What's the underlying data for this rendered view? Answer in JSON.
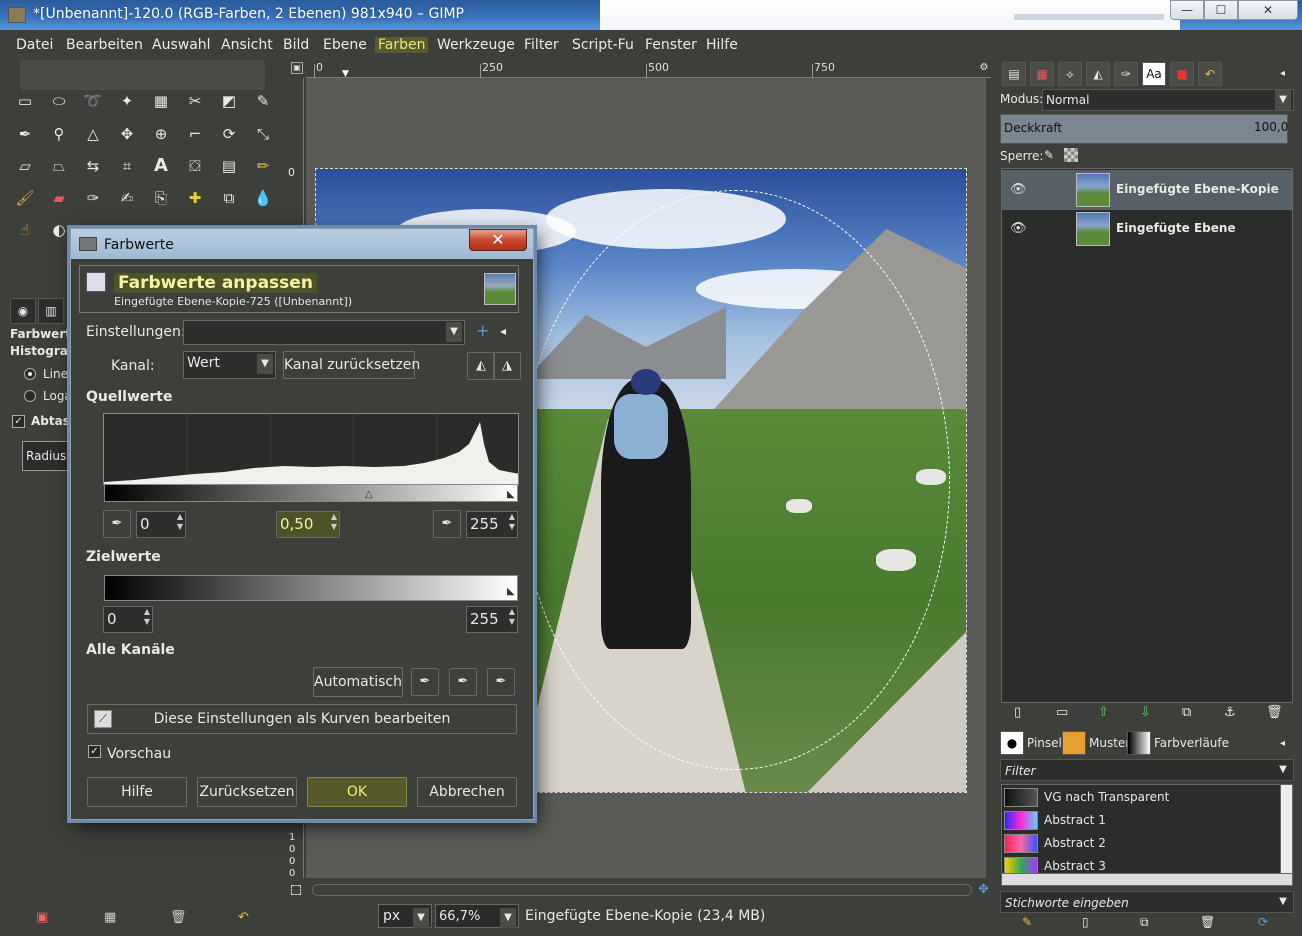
{
  "window": {
    "title": "*[Unbenannt]-120.0 (RGB-Farben, 2 Ebenen) 981x940 – GIMP",
    "minimize": "—",
    "maximize": "☐",
    "close": "✕"
  },
  "menu": {
    "items": [
      "Datei",
      "Bearbeiten",
      "Auswahl",
      "Ansicht",
      "Bild",
      "Ebene",
      "Farben",
      "Werkzeuge",
      "Filter",
      "Script-Fu",
      "Fenster",
      "Hilfe"
    ],
    "active": "Farben"
  },
  "toolbox": {
    "options_title_line1": "Farbwerte",
    "options_title_line2": "Histogram",
    "radio_linear": "Line",
    "radio_log": "Loga",
    "checkbox_label": "Abtast",
    "radius_label": "Radius",
    "tool_icons": [
      "rect-select-icon",
      "ellipse-select-icon",
      "lasso-icon",
      "fuzzy-select-icon",
      "color-select-icon",
      "scissors-icon",
      "foreground-select-icon",
      "paths-icon",
      "color-picker-icon",
      "zoom-icon",
      "measure-icon",
      "move-icon",
      "align-icon",
      "crop-icon",
      "rotate-icon",
      "scale-icon",
      "shear-icon",
      "perspective-icon",
      "flip-icon",
      "cage-icon",
      "text-icon",
      "bucket-fill-icon",
      "blend-icon",
      "pencil-icon",
      "paintbrush-icon",
      "eraser-icon",
      "airbrush-icon",
      "ink-icon",
      "clone-icon",
      "heal-icon",
      "perspective-clone-icon",
      "blur-icon",
      "smudge-icon",
      "dodge-icon"
    ]
  },
  "ruler": {
    "labels": [
      "0",
      "250",
      "500",
      "750"
    ],
    "vertical_labels": [
      "0"
    ],
    "vertical_bottom": [
      "1",
      "0",
      "0",
      "0"
    ]
  },
  "statusbar": {
    "unit": "px",
    "zoom": "66,7",
    "zoom_suffix": "%",
    "message": "Eingefügte Ebene-Kopie (23,4 MB)"
  },
  "layers_dock": {
    "mode_label": "Modus:",
    "mode_value": "Normal",
    "opacity_label": "Deckkraft",
    "opacity_value": "100,0",
    "lock_label": "Sperre:",
    "layers": [
      {
        "name": "Eingefügte Ebene-Kopie",
        "selected": true
      },
      {
        "name": "Eingefügte Ebene",
        "selected": false
      }
    ],
    "text_icon": "Aa"
  },
  "resources_dock": {
    "tabs": [
      "Pinsel",
      "Muster",
      "Farbverläufe"
    ],
    "filter_placeholder": "Filter",
    "gradients": [
      {
        "name": "VG nach Transparent",
        "colors": [
          "#111111",
          "#555555"
        ]
      },
      {
        "name": "Abstract 1",
        "colors": [
          "#2a2aff",
          "#ff2ad0",
          "#66ccff"
        ]
      },
      {
        "name": "Abstract 2",
        "colors": [
          "#ff2255",
          "#ff66aa",
          "#3355ff"
        ]
      },
      {
        "name": "Abstract 3",
        "colors": [
          "#ffcc00",
          "#33aa55",
          "#aa33ff"
        ]
      }
    ],
    "tags_placeholder": "Stichworte eingeben"
  },
  "dialog": {
    "title": "Farbwerte",
    "close": "✕",
    "header_title": "Farbwerte anpassen",
    "header_subtitle": "Eingefügte Ebene-Kopie-725 ([Unbenannt])",
    "settings_label": "Einstellungen:",
    "settings_value": "",
    "channel_label": "Kanal:",
    "channel_value": "Wert",
    "reset_channel": "Kanal zurücksetzen",
    "input_section": "Quellwerte",
    "input_low": "0",
    "input_gamma": "0,50",
    "input_high": "255",
    "output_section": "Zielwerte",
    "output_low": "0",
    "output_high": "255",
    "all_channels": "Alle Kanäle",
    "auto_button": "Automatisch",
    "curves_button": "Diese Einstellungen als Kurven bearbeiten",
    "preview_label": "Vorschau",
    "preview_checked": true,
    "buttons": {
      "help": "Hilfe",
      "reset": "Zurücksetzen",
      "ok": "OK",
      "cancel": "Abbrechen"
    }
  }
}
